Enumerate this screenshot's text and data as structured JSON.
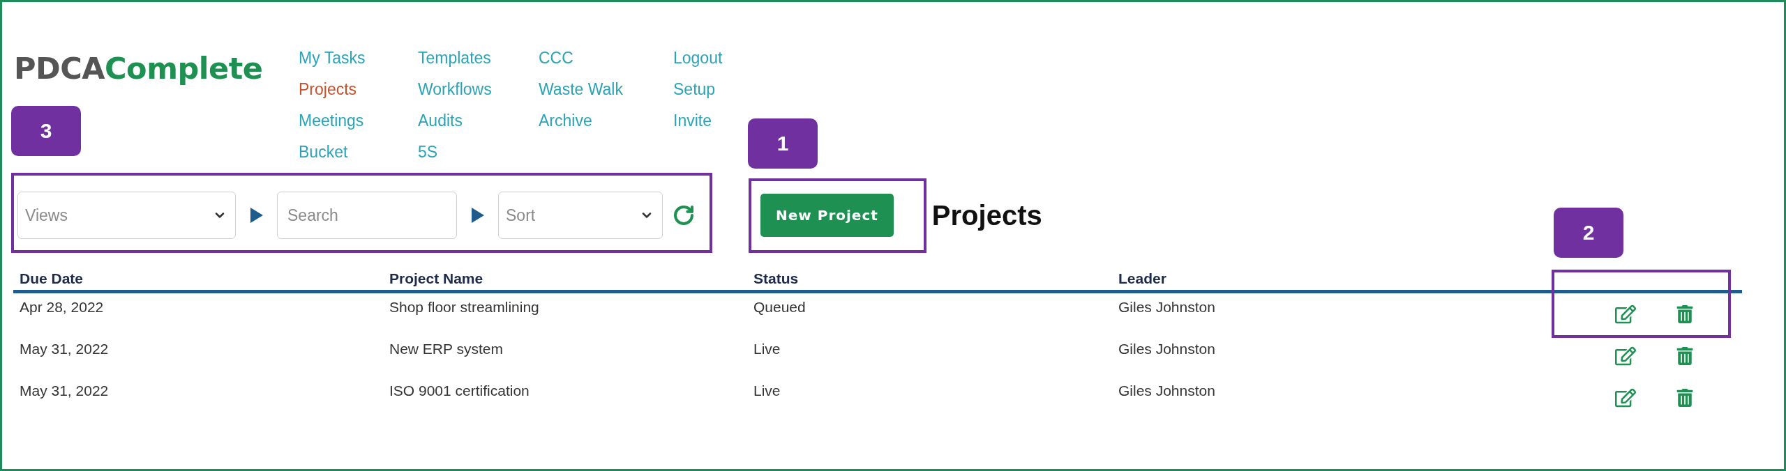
{
  "logo": {
    "dark": "PDCA",
    "green": "Complete"
  },
  "nav": [
    {
      "items": [
        {
          "label": "My Tasks",
          "selected": false
        },
        {
          "label": "Projects",
          "selected": true
        },
        {
          "label": "Meetings",
          "selected": false
        },
        {
          "label": "Bucket",
          "selected": false
        }
      ]
    },
    {
      "items": [
        {
          "label": "Templates",
          "selected": false
        },
        {
          "label": "Workflows",
          "selected": false
        },
        {
          "label": "Audits",
          "selected": false
        },
        {
          "label": "5S",
          "selected": false
        }
      ]
    },
    {
      "items": [
        {
          "label": "CCC",
          "selected": false
        },
        {
          "label": "Waste Walk",
          "selected": false
        },
        {
          "label": "Archive",
          "selected": false
        }
      ]
    },
    {
      "items": [
        {
          "label": "Logout",
          "selected": false
        },
        {
          "label": "Setup",
          "selected": false
        },
        {
          "label": "Invite",
          "selected": false
        }
      ]
    }
  ],
  "toolbar": {
    "views": {
      "placeholder": "Views"
    },
    "search": {
      "placeholder": "Search"
    },
    "sort": {
      "placeholder": "Sort"
    }
  },
  "new_project_button": "New Project",
  "page_title": "Projects",
  "table": {
    "columns": [
      "Due Date",
      "Project Name",
      "Status",
      "Leader"
    ],
    "rows": [
      {
        "cells": [
          "Apr 28, 2022",
          "Shop floor streamlining",
          "Queued",
          "Giles Johnston"
        ]
      },
      {
        "cells": [
          "May 31, 2022",
          "New ERP system",
          "Live",
          "Giles Johnston"
        ]
      },
      {
        "cells": [
          "May 31, 2022",
          "ISO 9001 certification",
          "Live",
          "Giles Johnston"
        ]
      }
    ]
  },
  "callouts": [
    {
      "number": "3"
    },
    {
      "number": "1"
    },
    {
      "number": "2"
    }
  ]
}
